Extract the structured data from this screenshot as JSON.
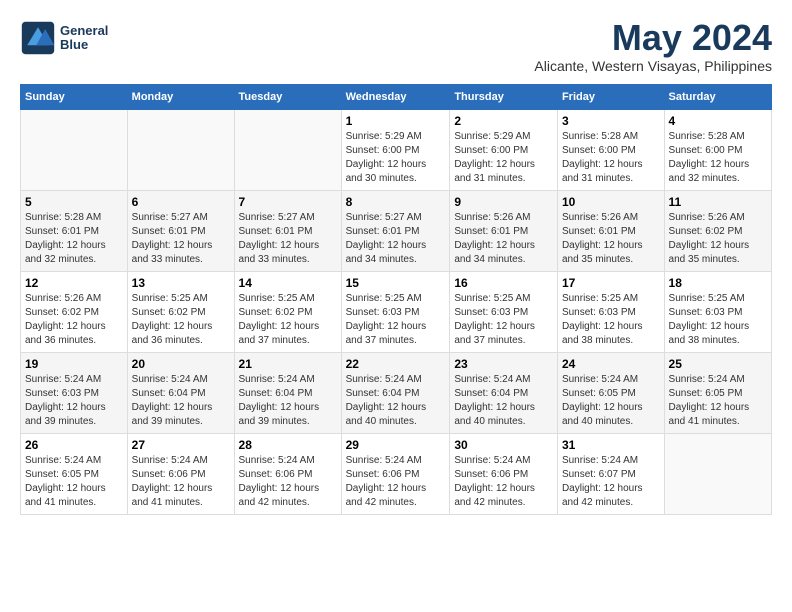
{
  "logo": {
    "line1": "General",
    "line2": "Blue"
  },
  "title": "May 2024",
  "location": "Alicante, Western Visayas, Philippines",
  "days_header": [
    "Sunday",
    "Monday",
    "Tuesday",
    "Wednesday",
    "Thursday",
    "Friday",
    "Saturday"
  ],
  "weeks": [
    [
      {
        "day": "",
        "info": ""
      },
      {
        "day": "",
        "info": ""
      },
      {
        "day": "",
        "info": ""
      },
      {
        "day": "1",
        "info": "Sunrise: 5:29 AM\nSunset: 6:00 PM\nDaylight: 12 hours\nand 30 minutes."
      },
      {
        "day": "2",
        "info": "Sunrise: 5:29 AM\nSunset: 6:00 PM\nDaylight: 12 hours\nand 31 minutes."
      },
      {
        "day": "3",
        "info": "Sunrise: 5:28 AM\nSunset: 6:00 PM\nDaylight: 12 hours\nand 31 minutes."
      },
      {
        "day": "4",
        "info": "Sunrise: 5:28 AM\nSunset: 6:00 PM\nDaylight: 12 hours\nand 32 minutes."
      }
    ],
    [
      {
        "day": "5",
        "info": "Sunrise: 5:28 AM\nSunset: 6:01 PM\nDaylight: 12 hours\nand 32 minutes."
      },
      {
        "day": "6",
        "info": "Sunrise: 5:27 AM\nSunset: 6:01 PM\nDaylight: 12 hours\nand 33 minutes."
      },
      {
        "day": "7",
        "info": "Sunrise: 5:27 AM\nSunset: 6:01 PM\nDaylight: 12 hours\nand 33 minutes."
      },
      {
        "day": "8",
        "info": "Sunrise: 5:27 AM\nSunset: 6:01 PM\nDaylight: 12 hours\nand 34 minutes."
      },
      {
        "day": "9",
        "info": "Sunrise: 5:26 AM\nSunset: 6:01 PM\nDaylight: 12 hours\nand 34 minutes."
      },
      {
        "day": "10",
        "info": "Sunrise: 5:26 AM\nSunset: 6:01 PM\nDaylight: 12 hours\nand 35 minutes."
      },
      {
        "day": "11",
        "info": "Sunrise: 5:26 AM\nSunset: 6:02 PM\nDaylight: 12 hours\nand 35 minutes."
      }
    ],
    [
      {
        "day": "12",
        "info": "Sunrise: 5:26 AM\nSunset: 6:02 PM\nDaylight: 12 hours\nand 36 minutes."
      },
      {
        "day": "13",
        "info": "Sunrise: 5:25 AM\nSunset: 6:02 PM\nDaylight: 12 hours\nand 36 minutes."
      },
      {
        "day": "14",
        "info": "Sunrise: 5:25 AM\nSunset: 6:02 PM\nDaylight: 12 hours\nand 37 minutes."
      },
      {
        "day": "15",
        "info": "Sunrise: 5:25 AM\nSunset: 6:03 PM\nDaylight: 12 hours\nand 37 minutes."
      },
      {
        "day": "16",
        "info": "Sunrise: 5:25 AM\nSunset: 6:03 PM\nDaylight: 12 hours\nand 37 minutes."
      },
      {
        "day": "17",
        "info": "Sunrise: 5:25 AM\nSunset: 6:03 PM\nDaylight: 12 hours\nand 38 minutes."
      },
      {
        "day": "18",
        "info": "Sunrise: 5:25 AM\nSunset: 6:03 PM\nDaylight: 12 hours\nand 38 minutes."
      }
    ],
    [
      {
        "day": "19",
        "info": "Sunrise: 5:24 AM\nSunset: 6:03 PM\nDaylight: 12 hours\nand 39 minutes."
      },
      {
        "day": "20",
        "info": "Sunrise: 5:24 AM\nSunset: 6:04 PM\nDaylight: 12 hours\nand 39 minutes."
      },
      {
        "day": "21",
        "info": "Sunrise: 5:24 AM\nSunset: 6:04 PM\nDaylight: 12 hours\nand 39 minutes."
      },
      {
        "day": "22",
        "info": "Sunrise: 5:24 AM\nSunset: 6:04 PM\nDaylight: 12 hours\nand 40 minutes."
      },
      {
        "day": "23",
        "info": "Sunrise: 5:24 AM\nSunset: 6:04 PM\nDaylight: 12 hours\nand 40 minutes."
      },
      {
        "day": "24",
        "info": "Sunrise: 5:24 AM\nSunset: 6:05 PM\nDaylight: 12 hours\nand 40 minutes."
      },
      {
        "day": "25",
        "info": "Sunrise: 5:24 AM\nSunset: 6:05 PM\nDaylight: 12 hours\nand 41 minutes."
      }
    ],
    [
      {
        "day": "26",
        "info": "Sunrise: 5:24 AM\nSunset: 6:05 PM\nDaylight: 12 hours\nand 41 minutes."
      },
      {
        "day": "27",
        "info": "Sunrise: 5:24 AM\nSunset: 6:06 PM\nDaylight: 12 hours\nand 41 minutes."
      },
      {
        "day": "28",
        "info": "Sunrise: 5:24 AM\nSunset: 6:06 PM\nDaylight: 12 hours\nand 42 minutes."
      },
      {
        "day": "29",
        "info": "Sunrise: 5:24 AM\nSunset: 6:06 PM\nDaylight: 12 hours\nand 42 minutes."
      },
      {
        "day": "30",
        "info": "Sunrise: 5:24 AM\nSunset: 6:06 PM\nDaylight: 12 hours\nand 42 minutes."
      },
      {
        "day": "31",
        "info": "Sunrise: 5:24 AM\nSunset: 6:07 PM\nDaylight: 12 hours\nand 42 minutes."
      },
      {
        "day": "",
        "info": ""
      }
    ]
  ]
}
